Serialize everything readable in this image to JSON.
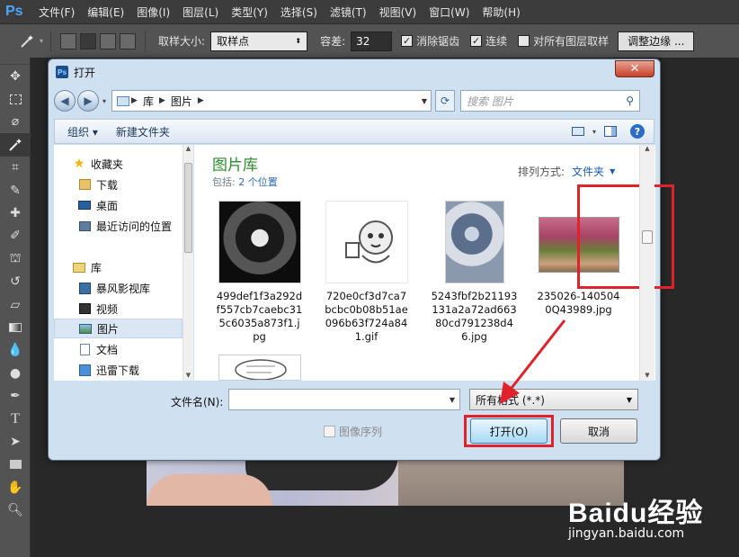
{
  "app": {
    "logo": "Ps",
    "menu": [
      "文件(F)",
      "编辑(E)",
      "图像(I)",
      "图层(L)",
      "类型(Y)",
      "选择(S)",
      "滤镜(T)",
      "视图(V)",
      "窗口(W)",
      "帮助(H)"
    ]
  },
  "options": {
    "sample_size_label": "取样大小:",
    "sample_size_value": "取样点",
    "tolerance_label": "容差:",
    "tolerance_value": "32",
    "antialias_label": "消除锯齿",
    "antialias_checked": true,
    "contiguous_label": "连续",
    "contiguous_checked": true,
    "all_layers_label": "对所有图层取样",
    "all_layers_checked": false,
    "refine_edge_label": "调整边缘 ..."
  },
  "dialog": {
    "title": "打开",
    "close_glyph": "✕",
    "breadcrumb": [
      "库",
      "图片"
    ],
    "search_placeholder": "搜索 图片",
    "organize_label": "组织 ▾",
    "new_folder_label": "新建文件夹",
    "nav": {
      "favorites_label": "收藏夹",
      "favorites": [
        "下载",
        "桌面",
        "最近访问的位置"
      ],
      "libraries_label": "库",
      "libraries": [
        "暴风影视库",
        "视频",
        "图片",
        "文档",
        "迅雷下载"
      ],
      "selected": "图片"
    },
    "library": {
      "title": "图片库",
      "includes_label": "包括:",
      "includes_value": "2 个位置",
      "arrange_label": "排列方式:",
      "arrange_value": "文件夹"
    },
    "files": [
      {
        "name": "499def1f3a292df557cb7caebc315c6035a873f1.jpg",
        "selected": false
      },
      {
        "name": "720e0cf3d7ca7bcbc0b08b51ae096b63f724a841.gif",
        "selected": false
      },
      {
        "name": "5243fbf2b21193131a2a72ad66380cd791238d46.jpg",
        "selected": false
      },
      {
        "name": "235026-1405040Q43989.jpg",
        "selected": true
      },
      {
        "name": "",
        "selected": false
      }
    ],
    "filename_label": "文件名(N):",
    "filename_value": "",
    "filetype_value": "所有格式 (*.*)",
    "image_sequence_label": "图像序列",
    "open_label": "打开(O)",
    "cancel_label": "取消"
  },
  "watermark": {
    "logo": "Baidu经验",
    "url": "jingyan.baidu.com"
  },
  "colors": {
    "highlight": "#e0222a",
    "library_title": "#2e8b2e",
    "link_blue": "#1e5ca8"
  },
  "tools": [
    "move-icon",
    "marquee-icon",
    "lasso-icon",
    "magic-wand-icon",
    "crop-icon",
    "eyedropper-icon",
    "healing-brush-icon",
    "brush-icon",
    "clone-stamp-icon",
    "history-brush-icon",
    "eraser-icon",
    "gradient-icon",
    "blur-icon",
    "dodge-icon",
    "pen-icon",
    "type-icon",
    "path-selection-icon",
    "shape-icon",
    "hand-icon",
    "zoom-icon"
  ]
}
